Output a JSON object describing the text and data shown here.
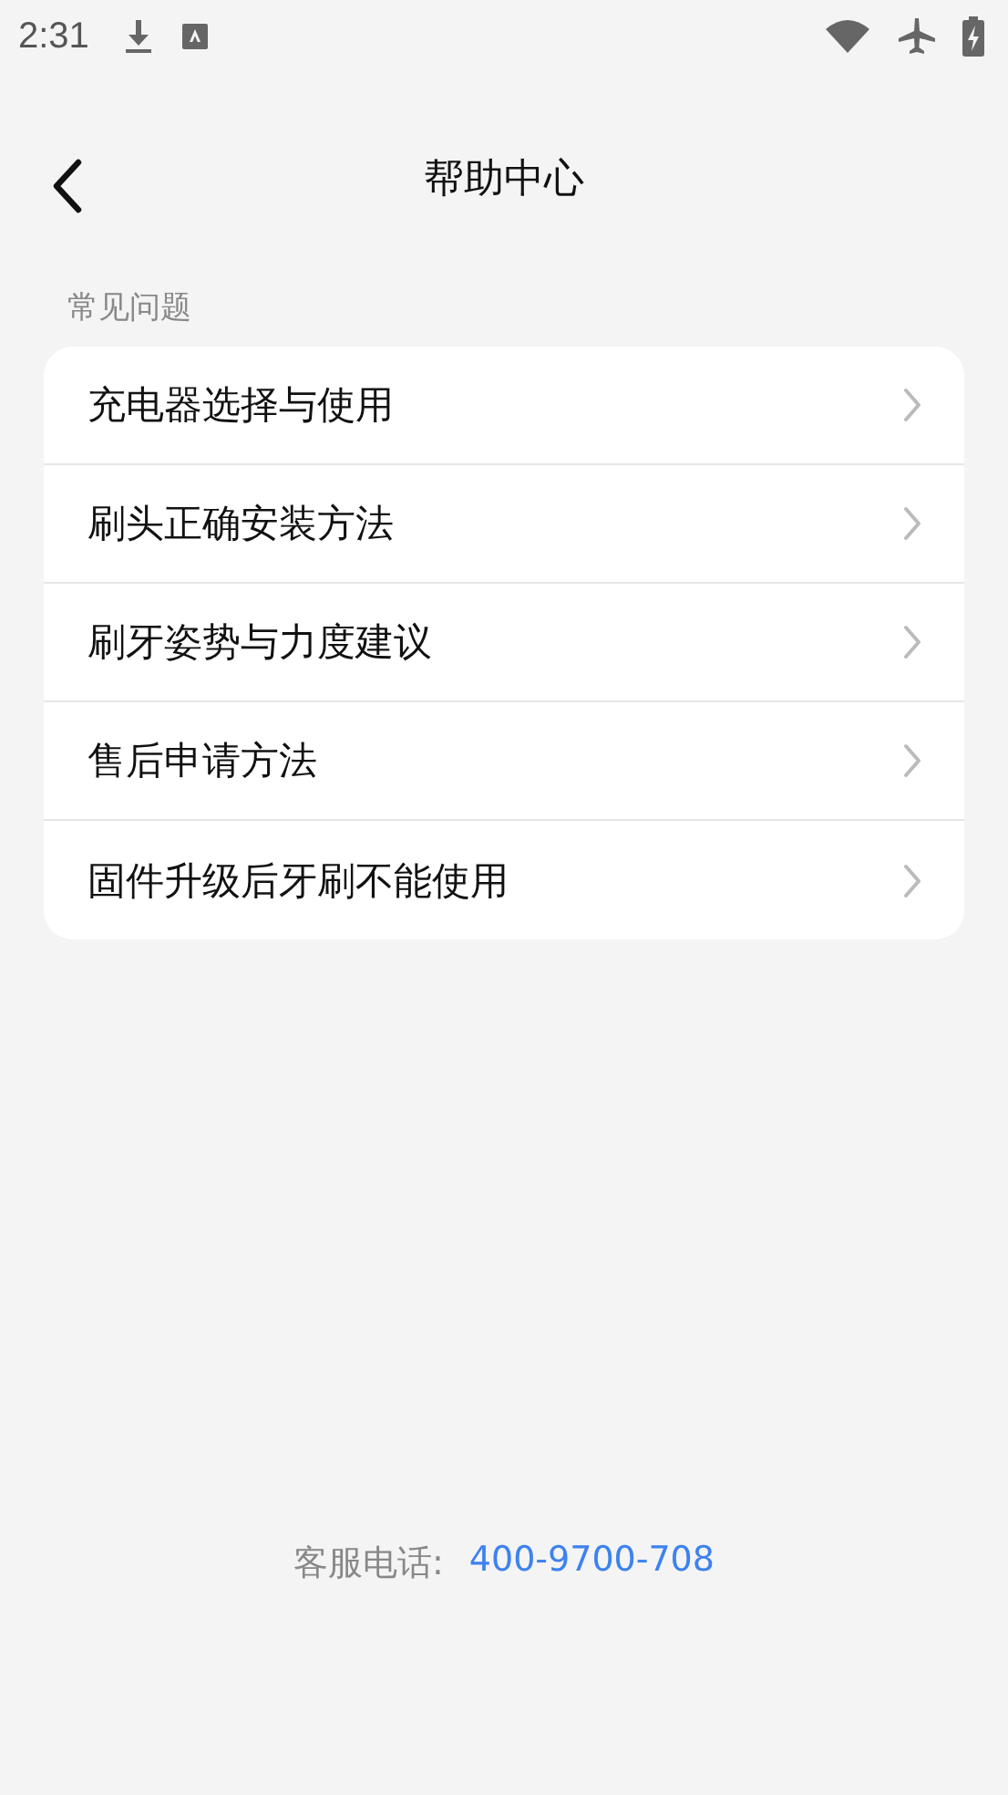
{
  "status_bar": {
    "time": "2:31"
  },
  "header": {
    "title": "帮助中心"
  },
  "section": {
    "title": "常见问题"
  },
  "faq": [
    {
      "label": "充电器选择与使用"
    },
    {
      "label": "刷头正确安装方法"
    },
    {
      "label": "刷牙姿势与力度建议"
    },
    {
      "label": "售后申请方法"
    },
    {
      "label": "固件升级后牙刷不能使用"
    }
  ],
  "footer": {
    "label": "客服电话:",
    "phone": "400-9700-708"
  }
}
